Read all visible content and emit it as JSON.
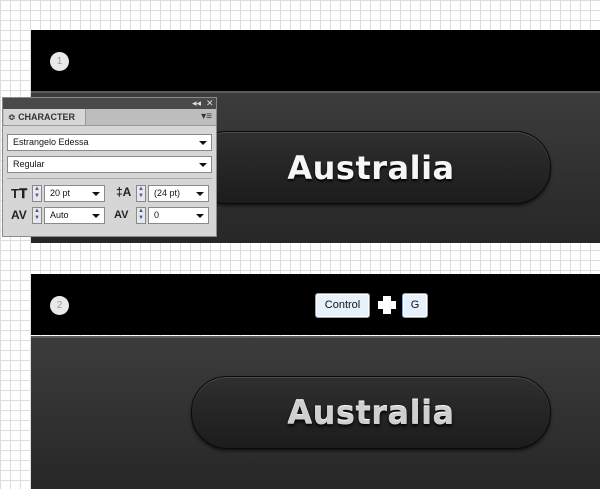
{
  "steps": [
    {
      "number": "1",
      "button_text": "Australia"
    },
    {
      "number": "2",
      "button_text": "Australia"
    }
  ],
  "character_panel": {
    "tab_label": "CHARACTER",
    "tab_marker": "≎",
    "collapse_glyph": "◂◂",
    "close_glyph": "✕",
    "menu_glyph": "▾≡",
    "font_family": "Estrangelo Edessa",
    "font_style": "Regular",
    "font_size": "20 pt",
    "leading": "(24 pt)",
    "kerning": "Auto",
    "tracking": "0",
    "icons": [
      "font-size-icon",
      "leading-icon",
      "kerning-icon",
      "tracking-icon"
    ]
  },
  "shortcut": {
    "key1": "Control",
    "key2": "G",
    "separator_icon": "plus-icon"
  },
  "colors": {
    "strip": "#000000",
    "pill_text": "#f6f6f6",
    "key_border": "#7aa6d4"
  }
}
